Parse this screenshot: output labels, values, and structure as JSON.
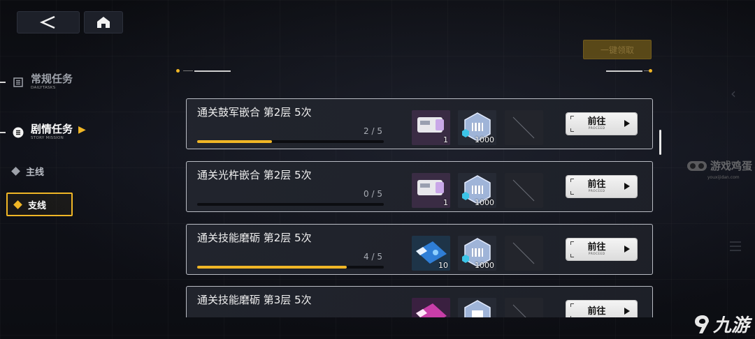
{
  "nav": {
    "back_icon": "back-arrow-icon",
    "home_icon": "home-icon"
  },
  "claim_all": {
    "label": "一键领取"
  },
  "sidebar": {
    "daily": {
      "title": "常规任务",
      "subtitle": "DAILYTASKS"
    },
    "story": {
      "title": "剧情任务",
      "subtitle": "STORY MISSION"
    },
    "sub_items": [
      {
        "label": "主线",
        "selected": false
      },
      {
        "label": "支线",
        "selected": true
      }
    ]
  },
  "tasks": [
    {
      "title": "通关鼓军嵌合 第2层 5次",
      "progress_text": "2 / 5",
      "progress": 0.4,
      "rewards": [
        {
          "icon": "white-device-icon",
          "qty": "1"
        },
        {
          "icon": "blue-crystal-icon",
          "qty": "1000"
        },
        {
          "icon": "empty-slot-icon",
          "qty": ""
        }
      ],
      "button": {
        "label": "前往",
        "sub": "PROCEED"
      }
    },
    {
      "title": "通关光杵嵌合 第2层 5次",
      "progress_text": "0 / 5",
      "progress": 0.0,
      "rewards": [
        {
          "icon": "white-device-icon",
          "qty": "1"
        },
        {
          "icon": "blue-crystal-icon",
          "qty": "1000"
        },
        {
          "icon": "empty-slot-icon",
          "qty": ""
        }
      ],
      "button": {
        "label": "前往",
        "sub": "PROCEED"
      }
    },
    {
      "title": "通关技能磨砺 第2层 5次",
      "progress_text": "4 / 5",
      "progress": 0.8,
      "rewards": [
        {
          "icon": "blue-ticket-icon",
          "qty": "10"
        },
        {
          "icon": "blue-crystal-icon",
          "qty": "1000"
        },
        {
          "icon": "empty-slot-icon",
          "qty": ""
        }
      ],
      "button": {
        "label": "前往",
        "sub": "PROCEED"
      }
    },
    {
      "title": "通关技能磨砺 第3层 5次",
      "progress_text": "",
      "progress": 0.0,
      "rewards": [
        {
          "icon": "pink-ticket-icon",
          "qty": ""
        },
        {
          "icon": "blue-crystal-icon",
          "qty": ""
        },
        {
          "icon": "empty-slot-icon",
          "qty": ""
        }
      ],
      "button": {
        "label": "前往",
        "sub": ""
      }
    }
  ],
  "watermarks": {
    "site1": "游戏鸡蛋",
    "site1_url": "youxijidan.com",
    "site2": "九游"
  },
  "colors": {
    "accent": "#f0b626",
    "card_border": "#b9bcc4",
    "background": "#0e1016"
  }
}
